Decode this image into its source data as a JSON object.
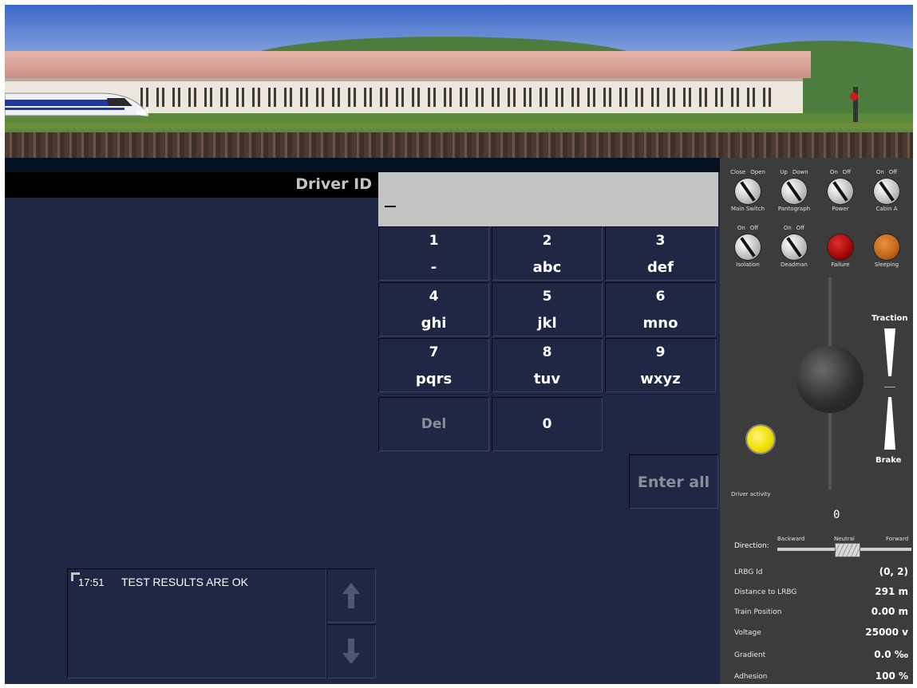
{
  "dmi": {
    "label": "Driver ID",
    "input_value": "_",
    "keys": [
      {
        "digit": "1",
        "letters": "-"
      },
      {
        "digit": "2",
        "letters": "abc"
      },
      {
        "digit": "3",
        "letters": "def"
      },
      {
        "digit": "4",
        "letters": "ghi"
      },
      {
        "digit": "5",
        "letters": "jkl"
      },
      {
        "digit": "6",
        "letters": "mno"
      },
      {
        "digit": "7",
        "letters": "pqrs"
      },
      {
        "digit": "8",
        "letters": "tuv"
      },
      {
        "digit": "9",
        "letters": "wxyz"
      }
    ],
    "del_label": "Del",
    "zero_label": "0",
    "enter_all_label": "Enter all",
    "message": {
      "time": "17:51",
      "text": "TEST RESULTS ARE OK"
    }
  },
  "controls": {
    "switches": [
      {
        "left": "Close",
        "right": "Open",
        "label": "Main Switch"
      },
      {
        "left": "Up",
        "right": "Down",
        "label": "Pantograph"
      },
      {
        "left": "On",
        "right": "Off",
        "label": "Power"
      },
      {
        "left": "On",
        "right": "Off",
        "label": "Cabin A"
      },
      {
        "left": "On",
        "right": "Off",
        "label": "Isolation"
      },
      {
        "left": "On",
        "right": "Off",
        "label": "Deadman"
      }
    ],
    "lamps": [
      {
        "label": "Failure",
        "color": "#b01010"
      },
      {
        "label": "Sleeping",
        "color": "#c86a14"
      }
    ],
    "traction_label": "Traction",
    "brake_label": "Brake",
    "driver_activity_label": "Driver activity",
    "speed_display": "0",
    "direction": {
      "label": "Direction:",
      "options": [
        "Backward",
        "Neutral",
        "Forward"
      ],
      "selected": "Neutral"
    },
    "readouts": [
      {
        "key": "LRBG Id",
        "value": "(0, 2)"
      },
      {
        "key": "Distance to LRBG",
        "value": "291  m"
      },
      {
        "key": "Train Position",
        "value": "0.00  m"
      },
      {
        "key": "Voltage",
        "value": "25000 v"
      },
      {
        "key": "Gradient",
        "value": "0.0 ‰"
      },
      {
        "key": "Adhesion",
        "value": "100 %"
      }
    ]
  },
  "colors": {
    "dmi_bg": "#202744",
    "label_bg": "#000000",
    "input_bg": "#c3c3c3",
    "panel_bg": "#3c3c3c",
    "activity": "#f0e000"
  }
}
